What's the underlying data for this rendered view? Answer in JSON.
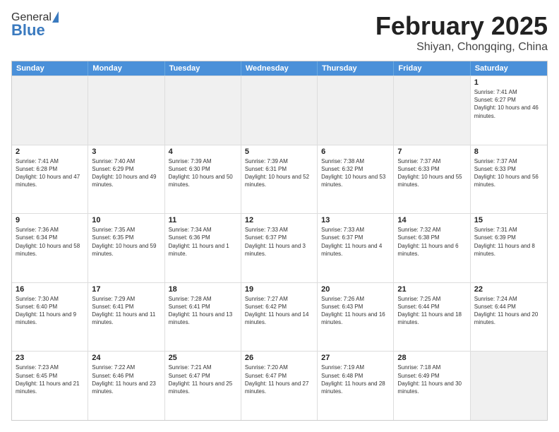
{
  "header": {
    "logo_general": "General",
    "logo_blue": "Blue",
    "main_title": "February 2025",
    "sub_title": "Shiyan, Chongqing, China"
  },
  "calendar": {
    "days_of_week": [
      "Sunday",
      "Monday",
      "Tuesday",
      "Wednesday",
      "Thursday",
      "Friday",
      "Saturday"
    ],
    "rows": [
      [
        {
          "day": "",
          "text": "",
          "shaded": true
        },
        {
          "day": "",
          "text": "",
          "shaded": true
        },
        {
          "day": "",
          "text": "",
          "shaded": true
        },
        {
          "day": "",
          "text": "",
          "shaded": true
        },
        {
          "day": "",
          "text": "",
          "shaded": true
        },
        {
          "day": "",
          "text": "",
          "shaded": true
        },
        {
          "day": "1",
          "text": "Sunrise: 7:41 AM\nSunset: 6:27 PM\nDaylight: 10 hours and 46 minutes.",
          "shaded": false
        }
      ],
      [
        {
          "day": "2",
          "text": "Sunrise: 7:41 AM\nSunset: 6:28 PM\nDaylight: 10 hours and 47 minutes.",
          "shaded": false
        },
        {
          "day": "3",
          "text": "Sunrise: 7:40 AM\nSunset: 6:29 PM\nDaylight: 10 hours and 49 minutes.",
          "shaded": false
        },
        {
          "day": "4",
          "text": "Sunrise: 7:39 AM\nSunset: 6:30 PM\nDaylight: 10 hours and 50 minutes.",
          "shaded": false
        },
        {
          "day": "5",
          "text": "Sunrise: 7:39 AM\nSunset: 6:31 PM\nDaylight: 10 hours and 52 minutes.",
          "shaded": false
        },
        {
          "day": "6",
          "text": "Sunrise: 7:38 AM\nSunset: 6:32 PM\nDaylight: 10 hours and 53 minutes.",
          "shaded": false
        },
        {
          "day": "7",
          "text": "Sunrise: 7:37 AM\nSunset: 6:33 PM\nDaylight: 10 hours and 55 minutes.",
          "shaded": false
        },
        {
          "day": "8",
          "text": "Sunrise: 7:37 AM\nSunset: 6:33 PM\nDaylight: 10 hours and 56 minutes.",
          "shaded": false
        }
      ],
      [
        {
          "day": "9",
          "text": "Sunrise: 7:36 AM\nSunset: 6:34 PM\nDaylight: 10 hours and 58 minutes.",
          "shaded": false
        },
        {
          "day": "10",
          "text": "Sunrise: 7:35 AM\nSunset: 6:35 PM\nDaylight: 10 hours and 59 minutes.",
          "shaded": false
        },
        {
          "day": "11",
          "text": "Sunrise: 7:34 AM\nSunset: 6:36 PM\nDaylight: 11 hours and 1 minute.",
          "shaded": false
        },
        {
          "day": "12",
          "text": "Sunrise: 7:33 AM\nSunset: 6:37 PM\nDaylight: 11 hours and 3 minutes.",
          "shaded": false
        },
        {
          "day": "13",
          "text": "Sunrise: 7:33 AM\nSunset: 6:37 PM\nDaylight: 11 hours and 4 minutes.",
          "shaded": false
        },
        {
          "day": "14",
          "text": "Sunrise: 7:32 AM\nSunset: 6:38 PM\nDaylight: 11 hours and 6 minutes.",
          "shaded": false
        },
        {
          "day": "15",
          "text": "Sunrise: 7:31 AM\nSunset: 6:39 PM\nDaylight: 11 hours and 8 minutes.",
          "shaded": false
        }
      ],
      [
        {
          "day": "16",
          "text": "Sunrise: 7:30 AM\nSunset: 6:40 PM\nDaylight: 11 hours and 9 minutes.",
          "shaded": false
        },
        {
          "day": "17",
          "text": "Sunrise: 7:29 AM\nSunset: 6:41 PM\nDaylight: 11 hours and 11 minutes.",
          "shaded": false
        },
        {
          "day": "18",
          "text": "Sunrise: 7:28 AM\nSunset: 6:41 PM\nDaylight: 11 hours and 13 minutes.",
          "shaded": false
        },
        {
          "day": "19",
          "text": "Sunrise: 7:27 AM\nSunset: 6:42 PM\nDaylight: 11 hours and 14 minutes.",
          "shaded": false
        },
        {
          "day": "20",
          "text": "Sunrise: 7:26 AM\nSunset: 6:43 PM\nDaylight: 11 hours and 16 minutes.",
          "shaded": false
        },
        {
          "day": "21",
          "text": "Sunrise: 7:25 AM\nSunset: 6:44 PM\nDaylight: 11 hours and 18 minutes.",
          "shaded": false
        },
        {
          "day": "22",
          "text": "Sunrise: 7:24 AM\nSunset: 6:44 PM\nDaylight: 11 hours and 20 minutes.",
          "shaded": false
        }
      ],
      [
        {
          "day": "23",
          "text": "Sunrise: 7:23 AM\nSunset: 6:45 PM\nDaylight: 11 hours and 21 minutes.",
          "shaded": false
        },
        {
          "day": "24",
          "text": "Sunrise: 7:22 AM\nSunset: 6:46 PM\nDaylight: 11 hours and 23 minutes.",
          "shaded": false
        },
        {
          "day": "25",
          "text": "Sunrise: 7:21 AM\nSunset: 6:47 PM\nDaylight: 11 hours and 25 minutes.",
          "shaded": false
        },
        {
          "day": "26",
          "text": "Sunrise: 7:20 AM\nSunset: 6:47 PM\nDaylight: 11 hours and 27 minutes.",
          "shaded": false
        },
        {
          "day": "27",
          "text": "Sunrise: 7:19 AM\nSunset: 6:48 PM\nDaylight: 11 hours and 28 minutes.",
          "shaded": false
        },
        {
          "day": "28",
          "text": "Sunrise: 7:18 AM\nSunset: 6:49 PM\nDaylight: 11 hours and 30 minutes.",
          "shaded": false
        },
        {
          "day": "",
          "text": "",
          "shaded": true
        }
      ]
    ]
  }
}
